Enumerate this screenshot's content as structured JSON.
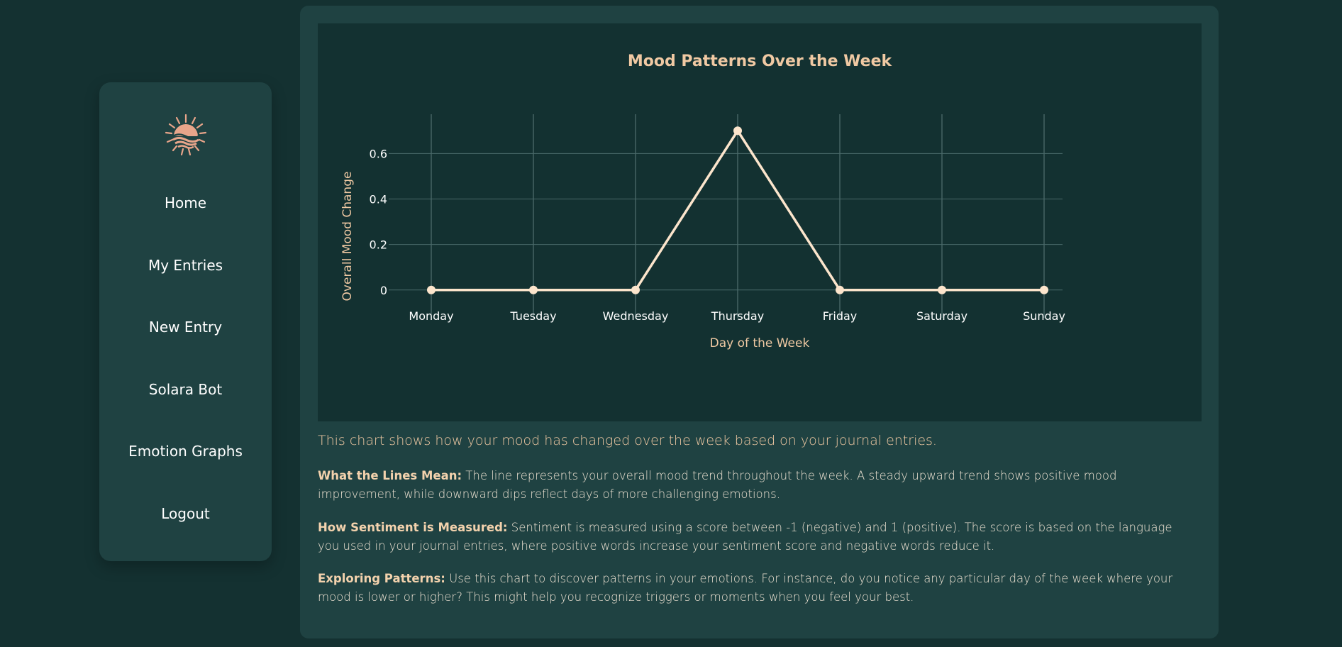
{
  "nav": {
    "logo_icon": "sun-waves-icon",
    "items": [
      {
        "label": "Home"
      },
      {
        "label": "My Entries"
      },
      {
        "label": "New Entry"
      },
      {
        "label": "Solara Bot"
      },
      {
        "label": "Emotion Graphs"
      },
      {
        "label": "Logout"
      }
    ]
  },
  "colors": {
    "background": "#143131",
    "panel": "#1f4242",
    "chart_bg": "#133131",
    "accent": "#f0c9a3",
    "line": "#fce5cc",
    "logo": "#e8a58a"
  },
  "chart_data": {
    "type": "line",
    "title": "Mood Patterns Over the Week",
    "xlabel": "Day of the Week",
    "ylabel": "Overall Mood Change",
    "categories": [
      "Monday",
      "Tuesday",
      "Wednesday",
      "Thursday",
      "Friday",
      "Saturday",
      "Sunday"
    ],
    "series": [
      {
        "values": [
          0,
          0,
          0,
          0.7,
          0,
          0,
          0
        ]
      }
    ],
    "yticks": [
      "0",
      "0.2",
      "0.4",
      "0.6"
    ],
    "ylim": [
      -0.06,
      0.76
    ],
    "grid": true
  },
  "content": {
    "summary": "This chart shows how your mood has changed over the week based on your journal entries.",
    "sections": [
      {
        "heading": "What the Lines Mean:",
        "text": " The line represents your overall mood trend throughout the week. A steady upward trend shows positive mood improvement, while downward dips reflect days of more challenging emotions."
      },
      {
        "heading": "How Sentiment is Measured:",
        "text": " Sentiment is measured using a score between -1 (negative) and 1 (positive). The score is based on the language you used in your journal entries, where positive words increase your sentiment score and negative words reduce it."
      },
      {
        "heading": "Exploring Patterns:",
        "text": " Use this chart to discover patterns in your emotions. For instance, do you notice any particular day of the week where your mood is lower or higher? This might help you recognize triggers or moments when you feel your best."
      }
    ]
  }
}
